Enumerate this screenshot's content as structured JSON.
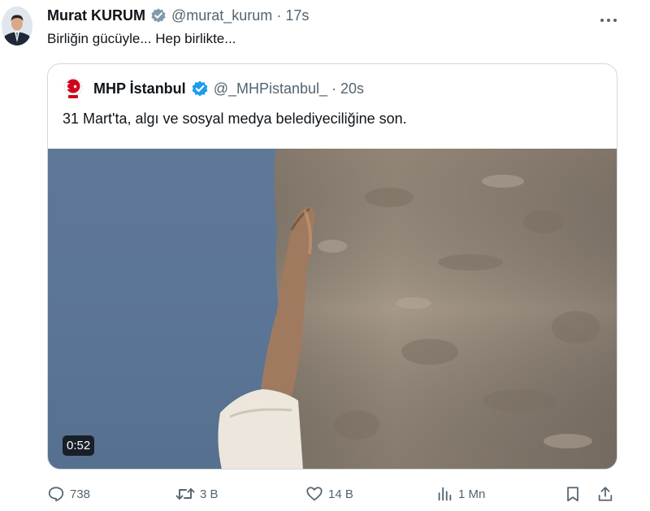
{
  "author": {
    "name": "Murat KURUM",
    "handle": "@murat_kurum",
    "dot": "·",
    "time": "17s",
    "verified_icon": "verified-gray-icon"
  },
  "tweet_text": "Birliğin gücüyle... Hep birlikte...",
  "quoted": {
    "name": "MHP İstanbul",
    "handle": "@_MHPistanbul_",
    "dot": "·",
    "time": "20s",
    "verified_icon": "verified-blue-icon",
    "text": "31 Mart'ta, algı ve sosyal medya belediyeciliğine son.",
    "video_duration": "0:52"
  },
  "actions": {
    "replies": "738",
    "reposts": "3 B",
    "likes": "14 B",
    "views": "1 Mn"
  },
  "colors": {
    "text": "#0f1419",
    "muted": "#536471",
    "border": "#cfd9de",
    "verified_blue": "#1d9bf0",
    "verified_gray": "#829aab",
    "mhp_red": "#d0021b"
  }
}
